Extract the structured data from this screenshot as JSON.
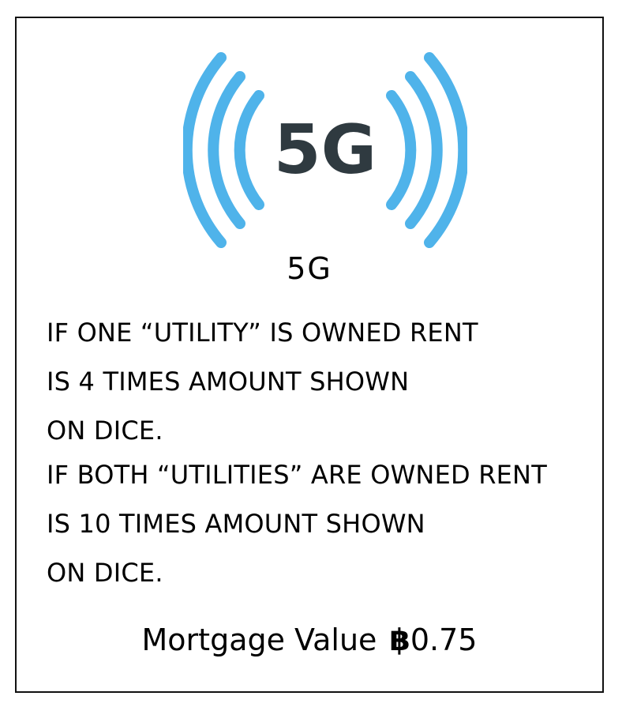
{
  "card": {
    "logo": {
      "icon": "5g-signal-icon",
      "text": "5G",
      "colors": {
        "waves": "#4fb3ea",
        "text": "#2f3a40"
      }
    },
    "title": "5G",
    "rules": [
      "IF ONE “UTILITY” IS OWNED RENT",
      "IS 4 TIMES AMOUNT SHOWN",
      "ON DICE.",
      "IF BOTH “UTILITIES” ARE OWNED RENT",
      "IS 10 TIMES AMOUNT SHOWN",
      "ON DICE."
    ],
    "mortgage": {
      "label": "Mortgage Value",
      "currency": "฿",
      "amount": "0.75"
    }
  }
}
